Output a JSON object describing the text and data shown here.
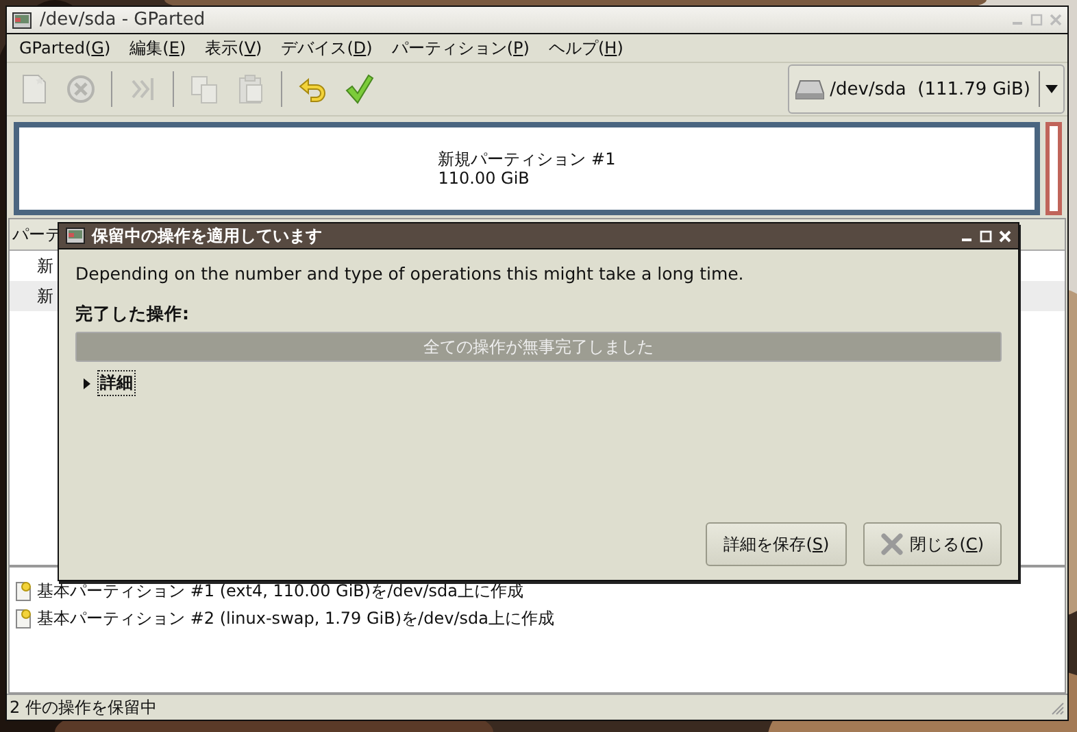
{
  "window": {
    "title": "/dev/sda - GParted"
  },
  "menu": [
    "GParted(G)",
    "編集(E)",
    "表示(V)",
    "デバイス(D)",
    "パーティション(P)",
    "ヘルプ(H)"
  ],
  "toolbar": [
    {
      "kind": "new",
      "disabled": true
    },
    {
      "kind": "delete",
      "disabled": true
    },
    {
      "kind": "separator"
    },
    {
      "kind": "resize",
      "disabled": true
    },
    {
      "kind": "separator"
    },
    {
      "kind": "copy",
      "disabled": true
    },
    {
      "kind": "paste",
      "disabled": true
    },
    {
      "kind": "separator"
    },
    {
      "kind": "undo",
      "disabled": false
    },
    {
      "kind": "apply",
      "disabled": false
    }
  ],
  "device_selector": {
    "value": "/dev/sda  (111.79 GiB)"
  },
  "disk_map": [
    {
      "name": "新規パーティション #1",
      "size": "110.00 GiB",
      "color": "#4a6580"
    },
    {
      "color": "#c0645a"
    }
  ],
  "partition_list": {
    "header": "パーテ",
    "rows": [
      "新",
      "新"
    ]
  },
  "dialog": {
    "title": "保留中の操作を適用しています",
    "message": "Depending on the number and type of operations this might take a long time.",
    "heading": "完了した操作:",
    "progress": {
      "level": 1,
      "text": "全ての操作が無事完了しました"
    },
    "details": {
      "label": "詳細",
      "expanded": false
    },
    "buttons": [
      {
        "label": "詳細を保存(S)",
        "kind": "save"
      },
      {
        "label": "閉じる(C)",
        "kind": "close"
      }
    ]
  },
  "operations": [
    "基本パーティション #1 (ext4, 110.00 GiB)を/dev/sda上に作成",
    "基本パーティション #2 (linux-swap, 1.79 GiB)を/dev/sda上に作成"
  ],
  "status_bar": "2 件の操作を保留中"
}
